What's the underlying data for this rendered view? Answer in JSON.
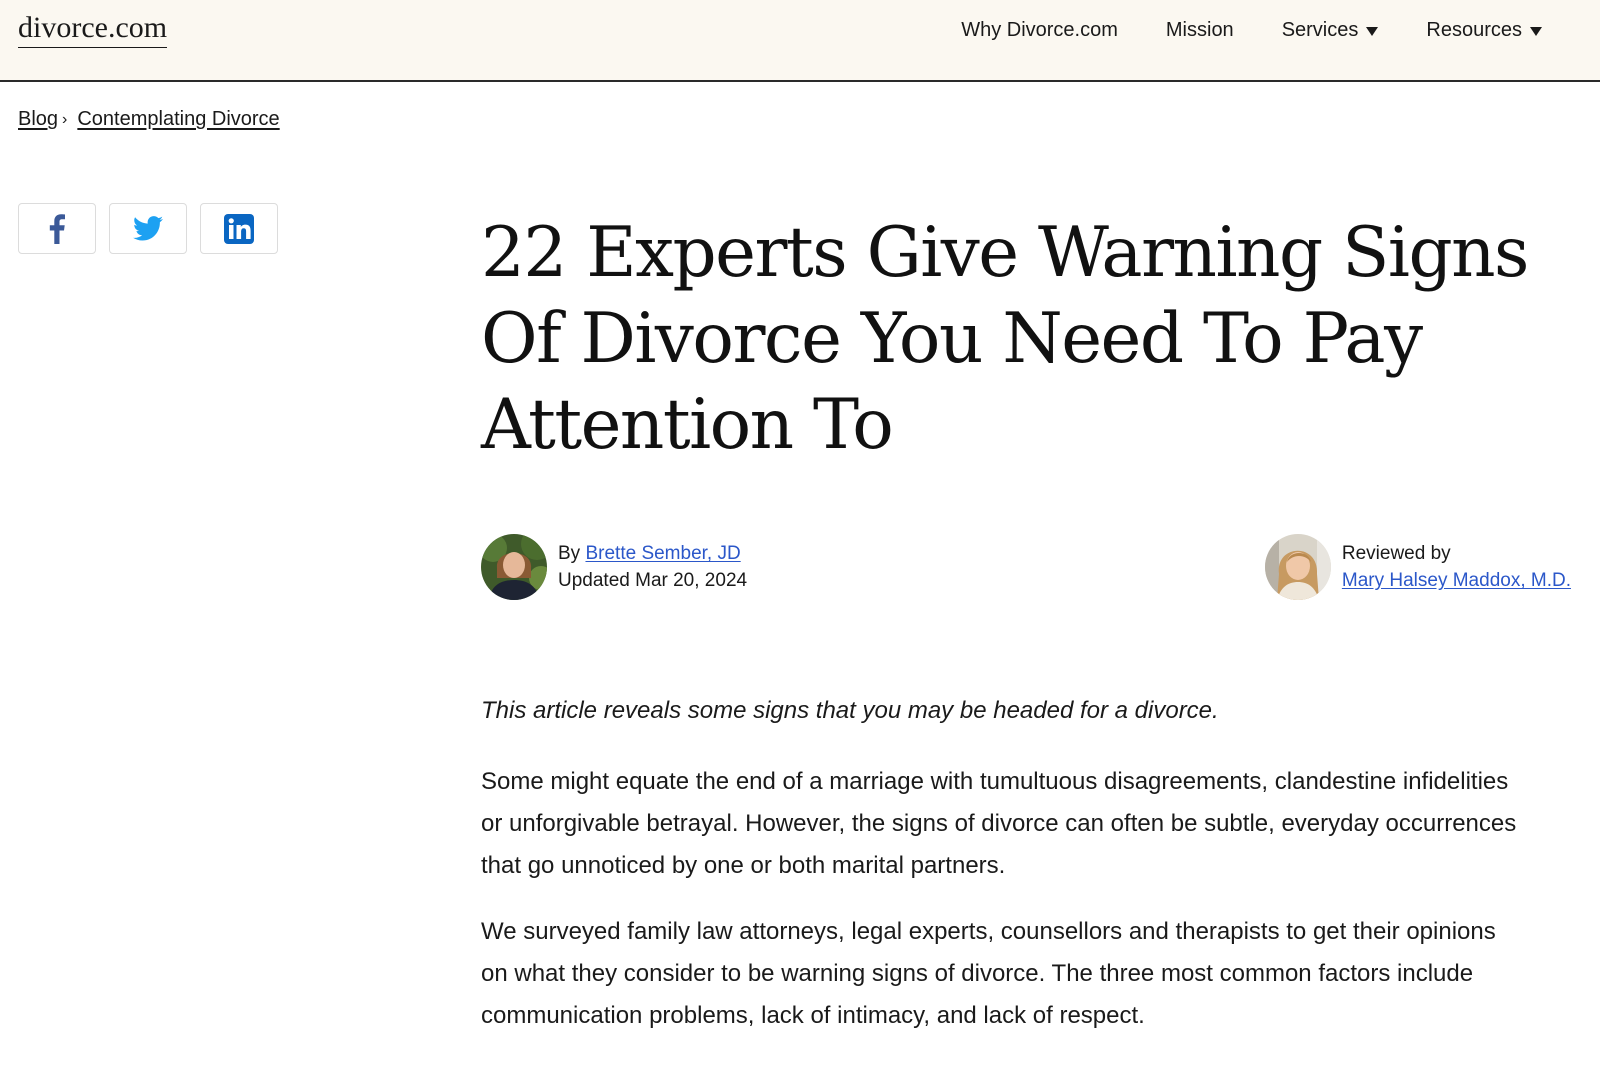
{
  "header": {
    "logo": "divorce.com",
    "nav": [
      {
        "label": "Why Divorce.com",
        "has_dropdown": false
      },
      {
        "label": "Mission",
        "has_dropdown": false
      },
      {
        "label": "Services",
        "has_dropdown": true
      },
      {
        "label": "Resources",
        "has_dropdown": true
      }
    ]
  },
  "breadcrumb": {
    "items": [
      "Blog",
      "Contemplating Divorce"
    ],
    "separator": "›"
  },
  "share": {
    "buttons": [
      "facebook-icon",
      "twitter-icon",
      "linkedin-icon"
    ],
    "colors": {
      "facebook": "#3b5998",
      "twitter": "#1da1f2",
      "linkedin": "#0a66c2"
    }
  },
  "article": {
    "title": "22 Experts Give Warning Signs Of Divorce You Need To Pay Attention To",
    "author": {
      "prefix": "By",
      "name": "Brette Sember, JD",
      "updated": "Updated Mar 20, 2024"
    },
    "reviewer": {
      "label": "Reviewed by",
      "name": "Mary Halsey Maddox, M.D."
    },
    "lede": "This article reveals some signs that you may be headed for a divorce.",
    "paragraphs": [
      "Some might equate the end of a marriage with tumultuous disagreements, clandestine infidelities or unforgivable betrayal. However, the signs of divorce can often be subtle, everyday occurrences that go unnoticed by one or both marital partners.",
      "We surveyed family law attorneys, legal experts, counsellors and therapists to get their opinions on what they consider to be warning signs of divorce. The three most common factors include communication problems, lack of intimacy, and lack of respect."
    ]
  },
  "colors": {
    "header_bg": "#fbf8f1",
    "link": "#2b57c9",
    "text": "#1a1a1a"
  }
}
